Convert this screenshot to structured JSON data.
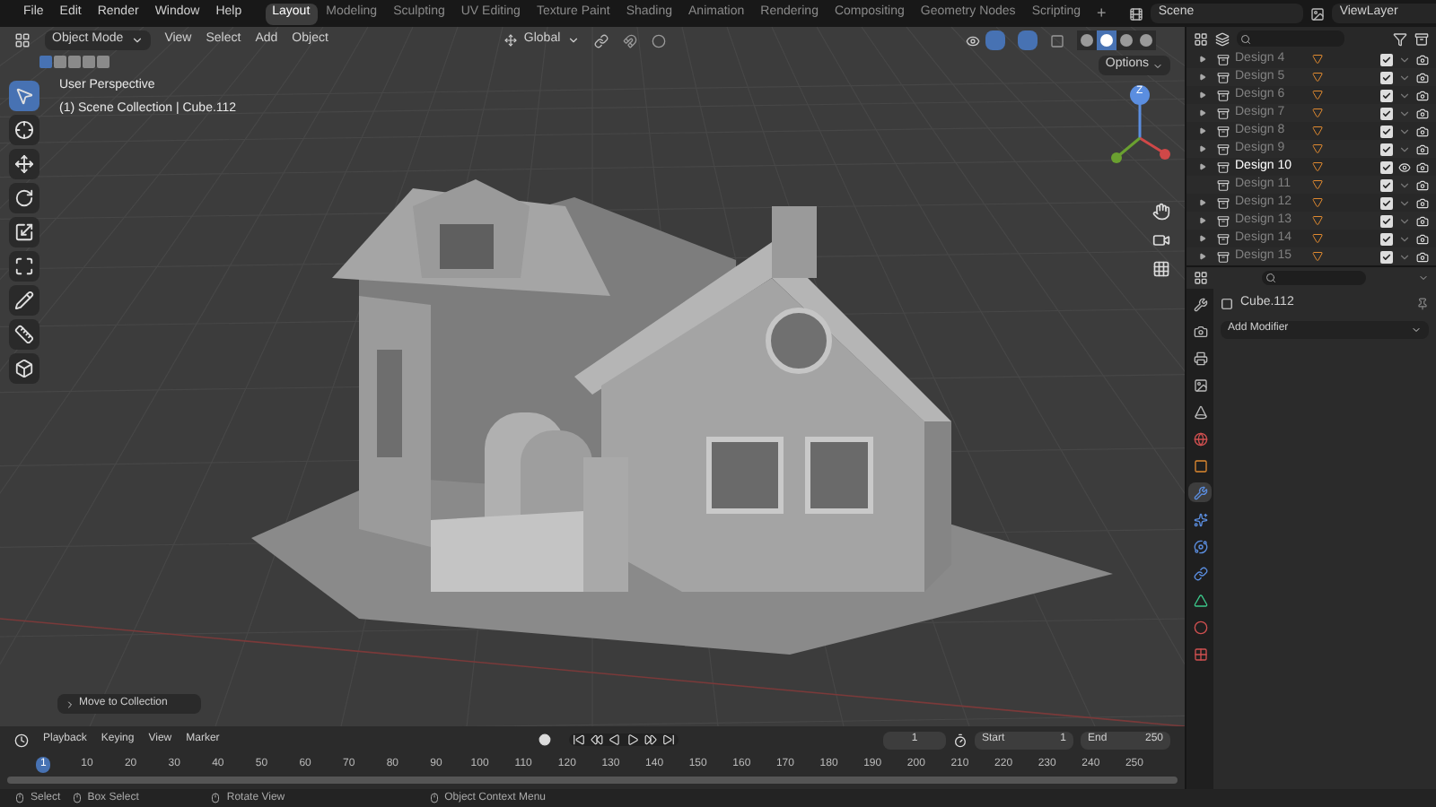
{
  "menu": [
    "File",
    "Edit",
    "Render",
    "Window",
    "Help"
  ],
  "workspaces": [
    {
      "label": "Layout",
      "selected": true
    },
    {
      "label": "Modeling",
      "selected": false
    },
    {
      "label": "Sculpting",
      "selected": false
    },
    {
      "label": "UV Editing",
      "selected": false
    },
    {
      "label": "Texture Paint",
      "selected": false
    },
    {
      "label": "Shading",
      "selected": false
    },
    {
      "label": "Animation",
      "selected": false
    },
    {
      "label": "Rendering",
      "selected": false
    },
    {
      "label": "Compositing",
      "selected": false
    },
    {
      "label": "Geometry Nodes",
      "selected": false
    },
    {
      "label": "Scripting",
      "selected": false
    }
  ],
  "add_workspace": "+",
  "scene": "Scene",
  "view_layer": "ViewLayer",
  "viewport": {
    "mode": "Object Mode",
    "menus": [
      "View",
      "Select",
      "Add",
      "Object"
    ],
    "orientation": "Global",
    "options": "Options",
    "select_modes": [
      {
        "selected": true
      },
      {
        "selected": false
      },
      {
        "selected": false
      },
      {
        "selected": false
      },
      {
        "selected": false
      }
    ],
    "shading": [
      {
        "kind": "wireframe",
        "selected": false
      },
      {
        "kind": "solid",
        "selected": true
      },
      {
        "kind": "material",
        "selected": false
      },
      {
        "kind": "rendered",
        "selected": false
      }
    ],
    "view_name": "User Perspective",
    "context": "(1) Scene Collection | Cube.112",
    "gizmo_axis": "Z",
    "tools": [
      {
        "kind": "select",
        "selected": true
      },
      {
        "kind": "cursor",
        "selected": false
      },
      {
        "kind": "move",
        "selected": false
      },
      {
        "kind": "rotate",
        "selected": false
      },
      {
        "kind": "scale",
        "selected": false
      },
      {
        "kind": "transform",
        "selected": false
      },
      {
        "kind": "annotate",
        "selected": false
      },
      {
        "kind": "measure",
        "selected": false
      },
      {
        "kind": "add_cube",
        "selected": false
      }
    ],
    "last_operator": "Move to Collection"
  },
  "outliner": {
    "rows": [
      {
        "name": "Design 4",
        "has_children": true,
        "active": false,
        "visible": false,
        "checked": true
      },
      {
        "name": "Design 5",
        "has_children": true,
        "active": false,
        "visible": false,
        "checked": true
      },
      {
        "name": "Design 6",
        "has_children": true,
        "active": false,
        "visible": false,
        "checked": true
      },
      {
        "name": "Design 7",
        "has_children": true,
        "active": false,
        "visible": false,
        "checked": true
      },
      {
        "name": "Design 8",
        "has_children": true,
        "active": false,
        "visible": false,
        "checked": true
      },
      {
        "name": "Design 9",
        "has_children": true,
        "active": false,
        "visible": false,
        "checked": true
      },
      {
        "name": "Design 10",
        "has_children": true,
        "active": true,
        "visible": true,
        "checked": true
      },
      {
        "name": "Design 11",
        "has_children": false,
        "active": false,
        "visible": false,
        "checked": true
      },
      {
        "name": "Design 12",
        "has_children": true,
        "active": false,
        "visible": false,
        "checked": true
      },
      {
        "name": "Design 13",
        "has_children": true,
        "active": false,
        "visible": false,
        "checked": true
      },
      {
        "name": "Design 14",
        "has_children": true,
        "active": false,
        "visible": false,
        "checked": true
      },
      {
        "name": "Design 15",
        "has_children": true,
        "active": false,
        "visible": false,
        "checked": true
      }
    ]
  },
  "properties": {
    "object": "Cube.112",
    "add_modifier": "Add Modifier",
    "tabs": [
      {
        "kind": "tool",
        "selected": false
      },
      {
        "kind": "render",
        "selected": false
      },
      {
        "kind": "output",
        "selected": false
      },
      {
        "kind": "view_layer",
        "selected": false
      },
      {
        "kind": "scene",
        "selected": false
      },
      {
        "kind": "world",
        "selected": false
      },
      {
        "kind": "object",
        "selected": false
      },
      {
        "kind": "modifiers",
        "selected": true
      },
      {
        "kind": "particles",
        "selected": false
      },
      {
        "kind": "physics",
        "selected": false
      },
      {
        "kind": "constraints",
        "selected": false
      },
      {
        "kind": "data",
        "selected": false
      },
      {
        "kind": "material",
        "selected": false
      },
      {
        "kind": "texture",
        "selected": false
      }
    ]
  },
  "timeline": {
    "menus": [
      "Playback",
      "Keying",
      "View",
      "Marker"
    ],
    "current_frame": "1",
    "start_label": "Start",
    "start": "1",
    "end_label": "End",
    "end": "250",
    "ticks": [
      {
        "label": "1",
        "selected": true
      },
      {
        "label": "10",
        "selected": false
      },
      {
        "label": "20",
        "selected": false
      },
      {
        "label": "30",
        "selected": false
      },
      {
        "label": "40",
        "selected": false
      },
      {
        "label": "50",
        "selected": false
      },
      {
        "label": "60",
        "selected": false
      },
      {
        "label": "70",
        "selected": false
      },
      {
        "label": "80",
        "selected": false
      },
      {
        "label": "90",
        "selected": false
      },
      {
        "label": "100",
        "selected": false
      },
      {
        "label": "110",
        "selected": false
      },
      {
        "label": "120",
        "selected": false
      },
      {
        "label": "130",
        "selected": false
      },
      {
        "label": "140",
        "selected": false
      },
      {
        "label": "150",
        "selected": false
      },
      {
        "label": "160",
        "selected": false
      },
      {
        "label": "170",
        "selected": false
      },
      {
        "label": "180",
        "selected": false
      },
      {
        "label": "190",
        "selected": false
      },
      {
        "label": "200",
        "selected": false
      },
      {
        "label": "210",
        "selected": false
      },
      {
        "label": "220",
        "selected": false
      },
      {
        "label": "230",
        "selected": false
      },
      {
        "label": "240",
        "selected": false
      },
      {
        "label": "250",
        "selected": false
      }
    ]
  },
  "status_bar": [
    "Select",
    "Box Select",
    "Rotate View",
    "Object Context Menu"
  ]
}
